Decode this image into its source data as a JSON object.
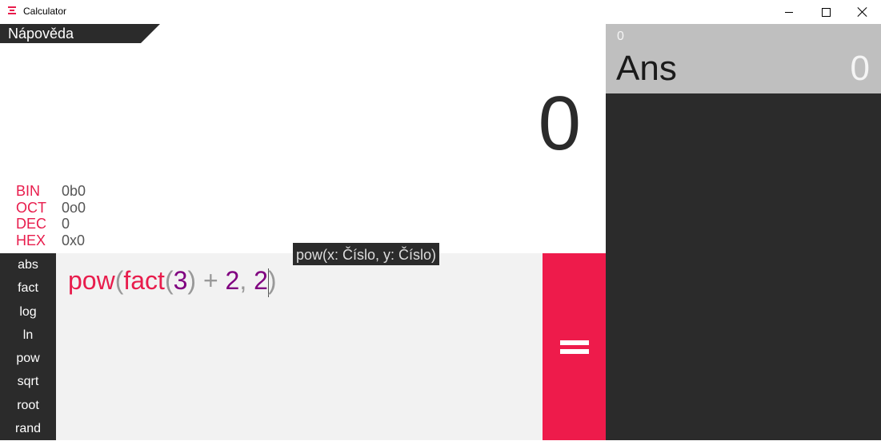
{
  "window": {
    "title": "Calculator"
  },
  "help": {
    "label": "Nápověda"
  },
  "result": {
    "value": "0"
  },
  "bases": [
    {
      "name": "BIN",
      "value": "0b0"
    },
    {
      "name": "OCT",
      "value": "0o0"
    },
    {
      "name": "DEC",
      "value": "0"
    },
    {
      "name": "HEX",
      "value": "0x0"
    }
  ],
  "functions": [
    "abs",
    "fact",
    "log",
    "ln",
    "pow",
    "sqrt",
    "root",
    "rand"
  ],
  "expression": {
    "tokens": [
      "pow",
      "(",
      "fact",
      "(",
      "3",
      ")",
      " + ",
      "2",
      ", ",
      "2",
      ")"
    ]
  },
  "tooltip": {
    "text": "pow(x: Číslo, y: Číslo)"
  },
  "history": [
    {
      "expression": "0",
      "name": "Ans",
      "value": "0"
    }
  ],
  "colors": {
    "accent": "#ee1b4b",
    "dark": "#2b2b2b",
    "editor_bg": "#f2f2f2",
    "history_item_bg": "#bfbfbf",
    "number": "#800080"
  }
}
